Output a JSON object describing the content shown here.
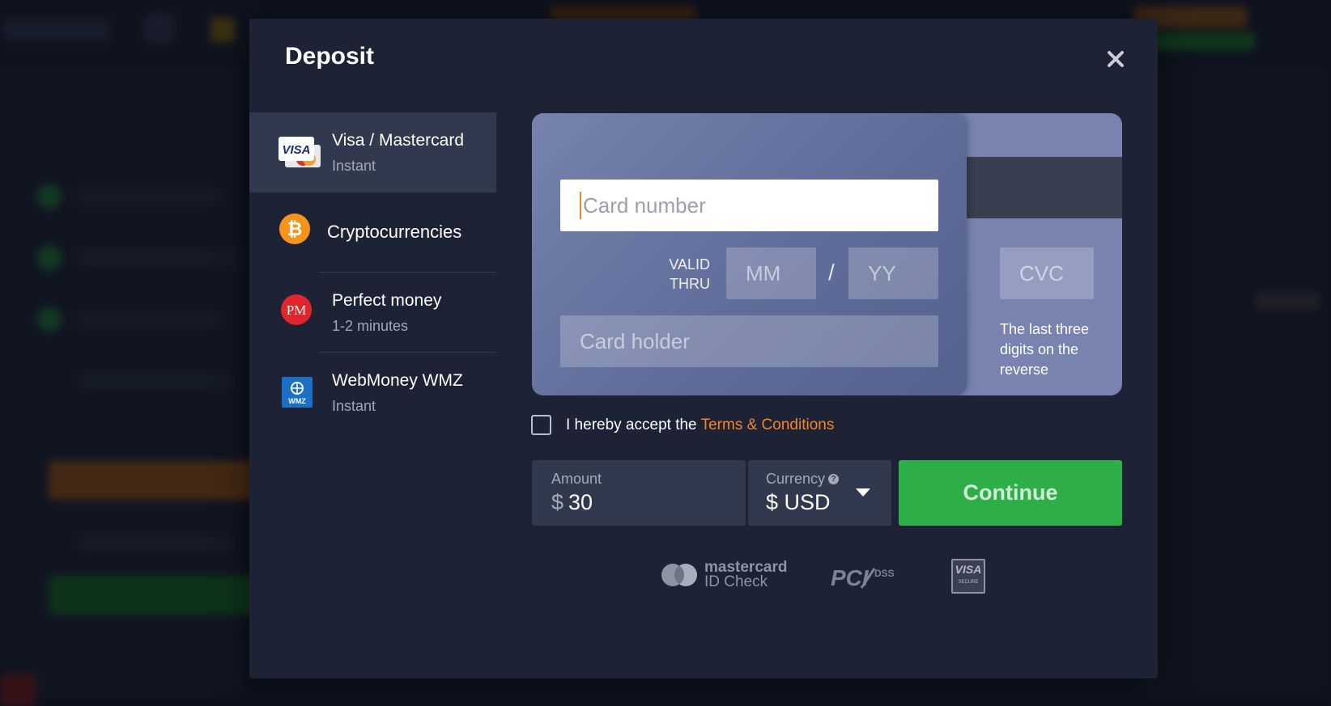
{
  "modal": {
    "title": "Deposit",
    "close_icon": "close-icon"
  },
  "methods": [
    {
      "name": "Visa / Mastercard",
      "sub": "Instant",
      "icon": "visa-mastercard-icon",
      "active": true
    },
    {
      "name": "Cryptocurrencies",
      "sub": "",
      "icon": "bitcoin-icon",
      "active": false
    },
    {
      "name": "Perfect money",
      "sub": "1-2 minutes",
      "icon": "perfect-money-icon",
      "active": false
    },
    {
      "name": "WebMoney WMZ",
      "sub": "Instant",
      "icon": "webmoney-icon",
      "active": false
    }
  ],
  "card": {
    "number_placeholder": "Card number",
    "valid_thru_line1": "VALID",
    "valid_thru_line2": "THRU",
    "mm_placeholder": "MM",
    "slash": "/",
    "yy_placeholder": "YY",
    "holder_placeholder": "Card holder",
    "cvc_placeholder": "CVC",
    "cvc_hint": "The last three digits on the reverse"
  },
  "terms": {
    "text": "I hereby accept the",
    "link": "Terms & Conditions",
    "checked": false
  },
  "amount": {
    "label": "Amount",
    "currency_symbol": "$",
    "value": "30"
  },
  "currency": {
    "label": "Currency",
    "help": "?",
    "value": "$ USD"
  },
  "continue_label": "Continue",
  "badges": {
    "mastercard_line1": "mastercard",
    "mastercard_line2": "ID Check",
    "pci": "PCI DSS",
    "visa_line1": "VISA",
    "visa_line2": "SECURE"
  },
  "colors": {
    "modal_bg": "#1d2234",
    "active_method_bg": "#31394f",
    "card_front": "#6b77a4",
    "continue_green": "#2eae48",
    "link_orange": "#f5852a",
    "caret_orange": "#e08a2a"
  }
}
